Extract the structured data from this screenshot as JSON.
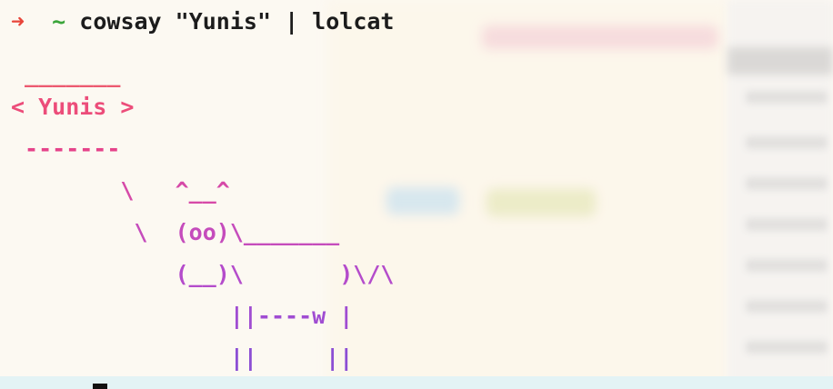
{
  "terminal": {
    "prompt_arrow": "➜",
    "prompt_dir": "~",
    "command": "cowsay \"Yunis\" | lolcat",
    "output": [
      " _______",
      "< Yunis >",
      " -------",
      "        \\   ^__^",
      "         \\  (oo)\\_______",
      "            (__)\\       )\\/\\",
      "                ||----w |",
      "                ||     ||"
    ]
  },
  "colors": {
    "arrow": "#e8453a",
    "tilde": "#3aa53a",
    "rainbow_start": "#ec5a70",
    "rainbow_end": "#8c4ed4"
  }
}
